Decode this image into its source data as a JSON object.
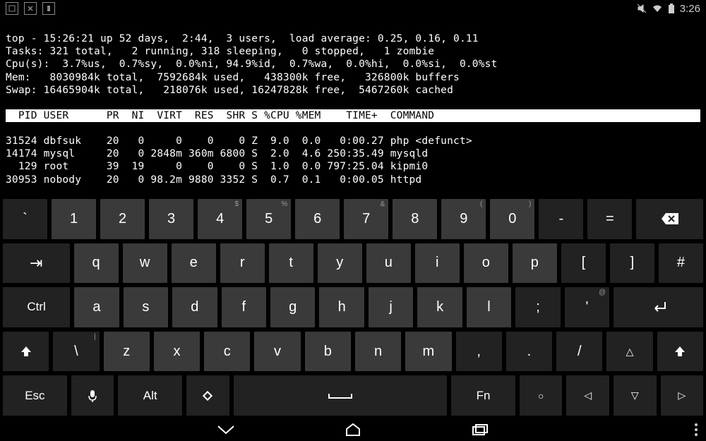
{
  "status_bar": {
    "time": "3:26"
  },
  "terminal": {
    "lines": [
      "top - 15:26:21 up 52 days,  2:44,  3 users,  load average: 0.25, 0.16, 0.11",
      "Tasks: 321 total,   2 running, 318 sleeping,   0 stopped,   1 zombie",
      "Cpu(s):  3.7%us,  0.7%sy,  0.0%ni, 94.9%id,  0.7%wa,  0.0%hi,  0.0%si,  0.0%st",
      "Mem:   8030984k total,  7592684k used,   438300k free,   326800k buffers",
      "Swap: 16465904k total,   218076k used, 16247828k free,  5467260k cached"
    ],
    "header": "  PID USER      PR  NI  VIRT  RES  SHR S %CPU %MEM    TIME+  COMMAND",
    "rows": [
      "31524 dbfsuk    20   0     0    0    0 Z  9.0  0.0   0:00.27 php <defunct>",
      "14174 mysql     20   0 2848m 360m 6800 S  2.0  4.6 250:35.49 mysqld",
      "  129 root      39  19     0    0    0 S  1.0  0.0 797:25.04 kipmi0",
      "30953 nobody    20   0 98.2m 9880 3352 S  0.7  0.1   0:00.05 httpd"
    ]
  },
  "keyboard": {
    "row1": [
      {
        "main": "`",
        "sup": ""
      },
      {
        "main": "1",
        "sup": ""
      },
      {
        "main": "2",
        "sup": ""
      },
      {
        "main": "3",
        "sup": ""
      },
      {
        "main": "4",
        "sup": "$"
      },
      {
        "main": "5",
        "sup": "%"
      },
      {
        "main": "6",
        "sup": ""
      },
      {
        "main": "7",
        "sup": "&"
      },
      {
        "main": "8",
        "sup": ""
      },
      {
        "main": "9",
        "sup": "("
      },
      {
        "main": "0",
        "sup": ")"
      },
      {
        "main": "-",
        "sup": ""
      },
      {
        "main": "=",
        "sup": ""
      }
    ],
    "row1_back": "⌫",
    "row2_tab": "⇥",
    "row2": [
      {
        "main": "q",
        "sup": ""
      },
      {
        "main": "w",
        "sup": ""
      },
      {
        "main": "e",
        "sup": ""
      },
      {
        "main": "r",
        "sup": ""
      },
      {
        "main": "t",
        "sup": ""
      },
      {
        "main": "y",
        "sup": ""
      },
      {
        "main": "u",
        "sup": ""
      },
      {
        "main": "i",
        "sup": ""
      },
      {
        "main": "o",
        "sup": ""
      },
      {
        "main": "p",
        "sup": ""
      },
      {
        "main": "[",
        "sup": ""
      },
      {
        "main": "]",
        "sup": ""
      },
      {
        "main": "#",
        "sup": ""
      }
    ],
    "row3_ctrl": "Ctrl",
    "row3": [
      {
        "main": "a",
        "sup": ""
      },
      {
        "main": "s",
        "sup": ""
      },
      {
        "main": "d",
        "sup": ""
      },
      {
        "main": "f",
        "sup": ""
      },
      {
        "main": "g",
        "sup": ""
      },
      {
        "main": "h",
        "sup": ""
      },
      {
        "main": "j",
        "sup": ""
      },
      {
        "main": "k",
        "sup": ""
      },
      {
        "main": "l",
        "sup": ""
      },
      {
        "main": ";",
        "sup": ""
      },
      {
        "main": "'",
        "sup": "@"
      }
    ],
    "row3_enter": "↵",
    "row4_shift": "⬆",
    "row4": [
      {
        "main": "\\",
        "sup": "|"
      },
      {
        "main": "z",
        "sup": ""
      },
      {
        "main": "x",
        "sup": ""
      },
      {
        "main": "c",
        "sup": ""
      },
      {
        "main": "v",
        "sup": ""
      },
      {
        "main": "b",
        "sup": ""
      },
      {
        "main": "n",
        "sup": ""
      },
      {
        "main": "m",
        "sup": ""
      },
      {
        "main": ",",
        "sup": ""
      },
      {
        "main": ".",
        "sup": ""
      },
      {
        "main": "/",
        "sup": ""
      }
    ],
    "row4_up": "△",
    "row4_shift2": "⬆",
    "row5": {
      "esc": "Esc",
      "mic": "🎤",
      "alt": "Alt",
      "sym": "◈",
      "space": "⎵",
      "fn": "Fn",
      "stop": "○",
      "left": "◁",
      "down": "▽",
      "right": "▷"
    }
  }
}
